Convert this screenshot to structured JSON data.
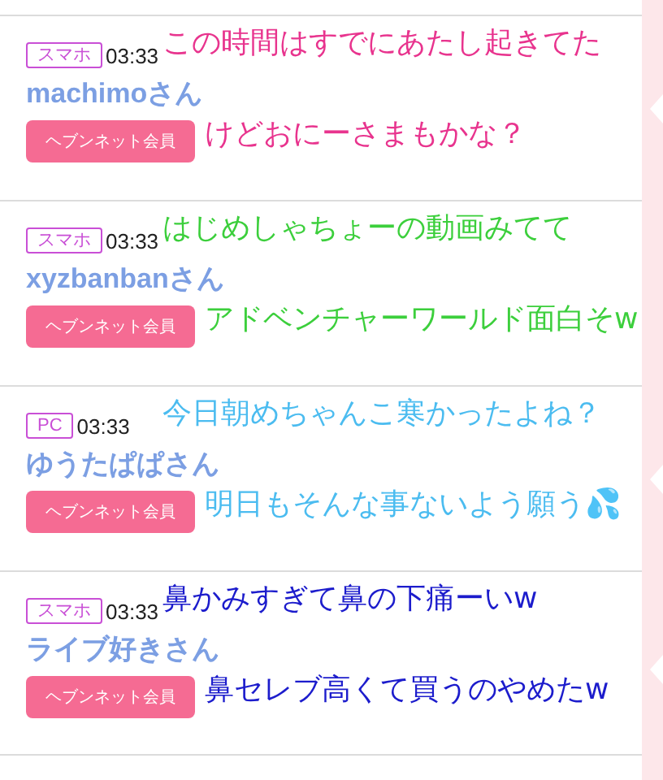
{
  "posts": [
    {
      "device": "スマホ",
      "time": "03:33",
      "name": "machimoさん",
      "badge": "ヘブンネット会員",
      "caption": {
        "color": "#e8348e",
        "lines": [
          "この時間はすでにあたし起きてた",
          "けどおにーさまもかな？"
        ]
      }
    },
    {
      "device": "スマホ",
      "time": "03:33",
      "name": "xyzbanbanさん",
      "badge": "ヘブンネット会員",
      "caption": {
        "color": "#3ccf3c",
        "lines": [
          "はじめしゃちょーの動画みてて",
          "アドベンチャーワールド面白そw"
        ]
      }
    },
    {
      "device": "PC",
      "time": "03:33",
      "name": "ゆうたぱぱさん",
      "badge": "ヘブンネット会員",
      "caption": {
        "color": "#4bbcf0",
        "lines": [
          "今日朝めちゃんこ寒かったよね？",
          "明日もそんな事ないよう願う💦"
        ]
      }
    },
    {
      "device": "スマホ",
      "time": "03:33",
      "name": "ライブ好きさん",
      "badge": "ヘブンネット会員",
      "caption": {
        "color": "#1c1ccc",
        "lines": [
          "鼻かみすぎて鼻の下痛ーいw",
          "鼻セレブ高くて買うのやめたw"
        ]
      }
    }
  ]
}
